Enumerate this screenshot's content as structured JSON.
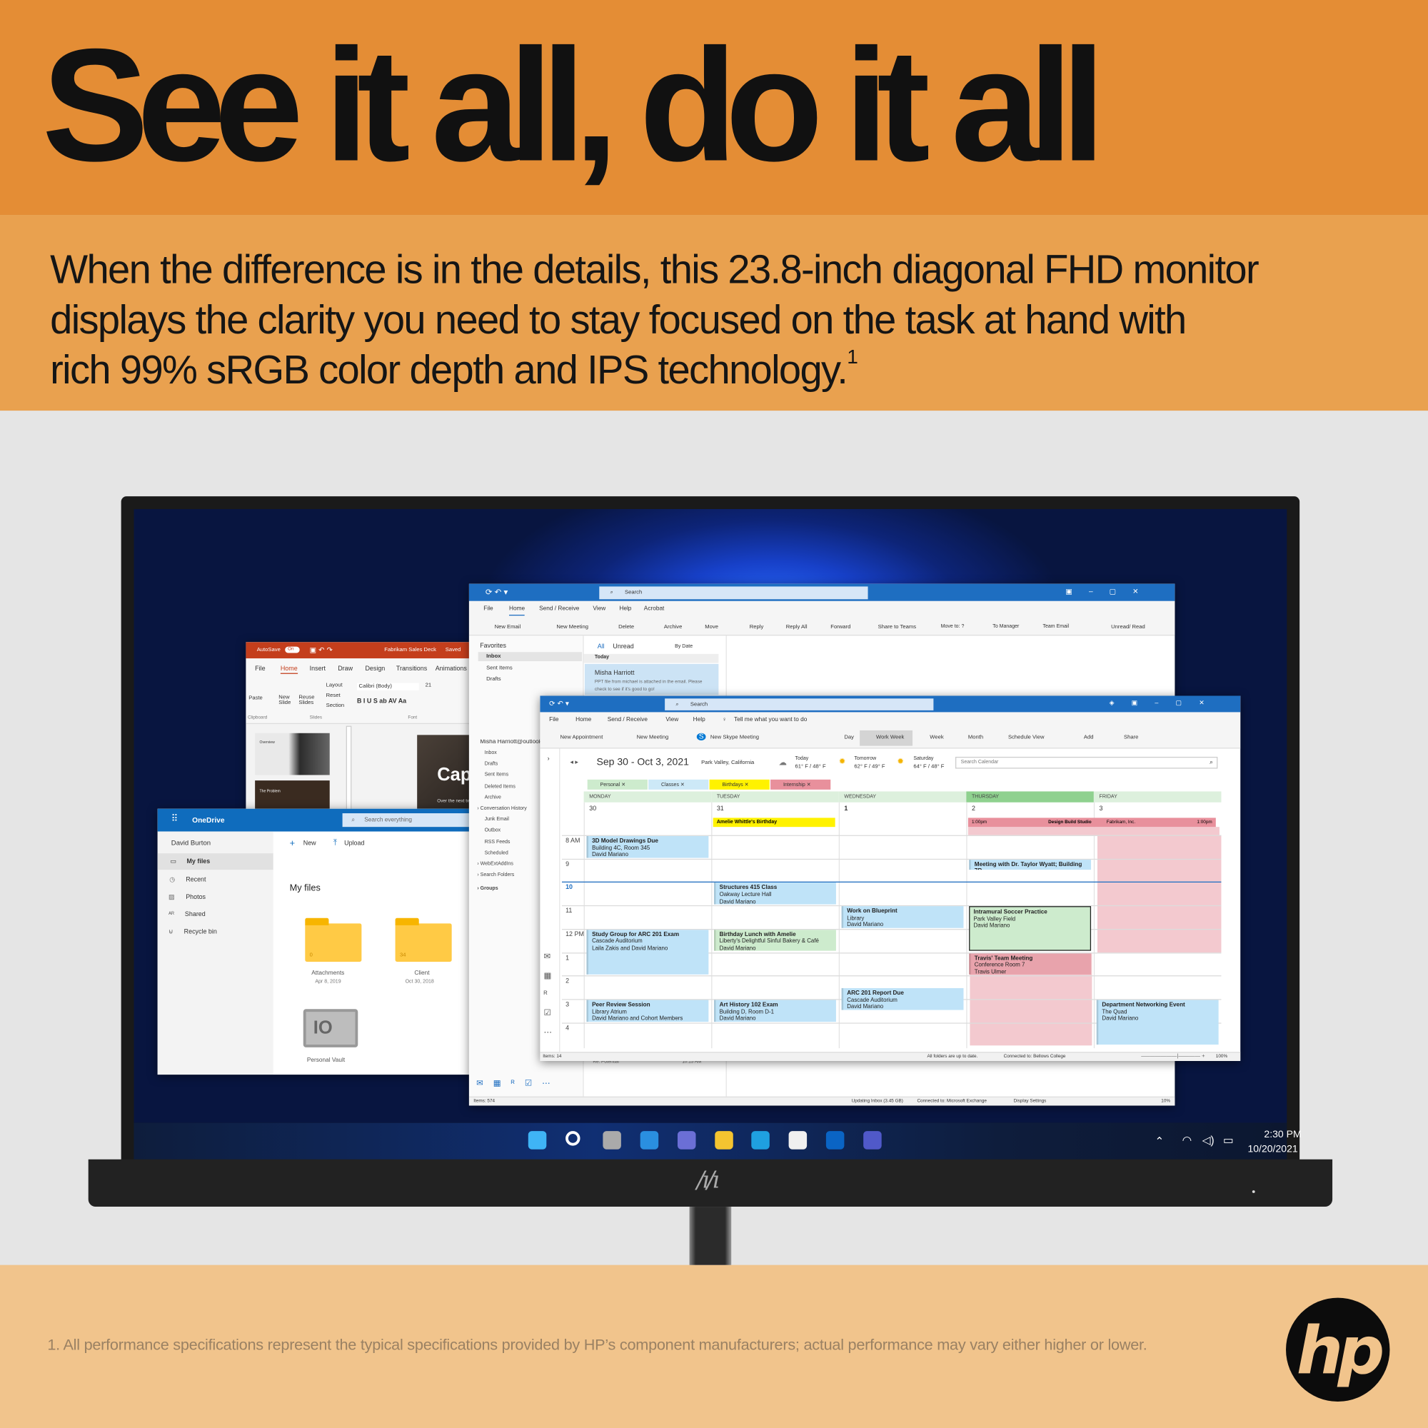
{
  "hero": {
    "headline": "See it all, do it all",
    "body_lines": [
      "When the difference is in the details, this 23.8-inch diagonal FHD monitor",
      "displays the clarity you need to stay focused on the task at hand with",
      "rich 99% sRGB color depth and IPS technology."
    ],
    "footnote_mark": "1",
    "footnote": "1. All performance specifications represent the typical specifications provided by HP’s component manufacturers; actual performance may vary either higher or lower.",
    "brand_logo": "hp"
  },
  "colors": {
    "band_top": "#E48D35",
    "band_sub": "#E9A14F",
    "band_bottom": "#F1C48C",
    "outlook_blue": "#1E6EC1",
    "ppt_red": "#C43E1C"
  },
  "powerpoint": {
    "autosave": "AutoSave",
    "autosave_state": "On",
    "doc_title": "Fabrikam Sales Deck",
    "saved": "Saved",
    "tabs": [
      "File",
      "Home",
      "Insert",
      "Draw",
      "Design",
      "Transitions",
      "Animations"
    ],
    "ribbon": {
      "paste": "Paste",
      "new_slide": "New Slide",
      "reuse": "Reuse Slides",
      "layout": "Layout",
      "reset": "Reset",
      "section": "Section",
      "font": "Calibri (Body)",
      "size": "21",
      "groups": [
        "Clipboard",
        "Slides",
        "Font"
      ]
    },
    "slide_text": "Cap",
    "slide_sub": "Over the next tw",
    "thumb1": "Overview",
    "thumb2": "The Problem"
  },
  "onedrive": {
    "app": "OneDrive",
    "search_placeholder": "Search everything",
    "user": "David Burton",
    "nav": [
      "My files",
      "Recent",
      "Photos",
      "Shared",
      "Recycle bin"
    ],
    "new": "New",
    "upload": "Upload",
    "heading": "My files",
    "items": [
      {
        "name": "Attachments",
        "date": "Apr 8, 2019",
        "count": "0"
      },
      {
        "name": "Client",
        "date": "Oct 30, 2018",
        "count": "34"
      },
      {
        "name": "Personal Vault"
      }
    ]
  },
  "mail": {
    "search": "Search",
    "menu": [
      "File",
      "Home",
      "Send / Receive",
      "View",
      "Help",
      "Acrobat"
    ],
    "ribbon": [
      "New Email",
      "New Meeting",
      "Delete",
      "Archive",
      "Move",
      "Reply",
      "Reply All",
      "Forward",
      "Share to Teams",
      "Move to: ?",
      "To Manager",
      "Team Email",
      "Unread/ Read"
    ],
    "favorites": "Favorites",
    "fav_items": [
      "Inbox",
      "Sent Items",
      "Drafts"
    ],
    "account": "Misha Harriott@outlook.com",
    "folders": [
      "Inbox",
      "Drafts",
      "Sent Items",
      "Deleted Items",
      "Archive",
      "Conversation History",
      "Junk Email",
      "Outbox",
      "RSS Feeds",
      "Scheduled",
      "WebExtAddIns",
      "Search Folders",
      "Groups"
    ],
    "filter_all": "All",
    "filter_unread": "Unread",
    "sort": "By Date",
    "group": "Today",
    "message": {
      "from": "Misha Harriott",
      "preview": "PPT file from michael is attached in the email. Please check to see if it's good to go!"
    },
    "peek_subject": "Re: Potential",
    "peek_time": "10:15 AM",
    "status": {
      "items": "Items: 574",
      "updating": "Updating Inbox (3.45 GB)",
      "connected": "Connected to: Microsoft Exchange",
      "display": "Display Settings",
      "zoom": "10%"
    }
  },
  "calendar": {
    "search": "Search",
    "menu": [
      "File",
      "Home",
      "Send / Receive",
      "View",
      "Help"
    ],
    "tell_me": "Tell me what you want to do",
    "ribbon": [
      "New Appointment",
      "New Meeting",
      "New Skype Meeting",
      "Day",
      "Work Week",
      "Week",
      "Month",
      "Schedule View",
      "Add",
      "Share"
    ],
    "active_view": "Work Week",
    "range": "Sep 30 - Oct 3, 2021",
    "location": "Park Valley, California",
    "weather": [
      {
        "label": "Today",
        "temp": "61° F / 48° F"
      },
      {
        "label": "Tomorrow",
        "temp": "62° F / 49° F"
      },
      {
        "label": "Saturday",
        "temp": "64° F / 48° F"
      }
    ],
    "search_placeholder": "Search Calendar",
    "categories": [
      {
        "name": "Personal",
        "color": "#CDEBCD"
      },
      {
        "name": "Classes",
        "color": "#CDE9F7"
      },
      {
        "name": "Birthdays",
        "color": "#FFF200"
      },
      {
        "name": "Internship",
        "color": "#E8909C"
      }
    ],
    "days": [
      {
        "name": "MONDAY",
        "date": "30"
      },
      {
        "name": "TUESDAY",
        "date": "31"
      },
      {
        "name": "WEDNESDAY",
        "date": "1"
      },
      {
        "name": "THURSDAY",
        "date": "2"
      },
      {
        "name": "FRIDAY",
        "date": "3"
      }
    ],
    "hours": [
      "8 AM",
      "9",
      "10",
      "11",
      "12 PM",
      "1",
      "2",
      "3",
      "4"
    ],
    "allday": [
      {
        "day": 1,
        "title": "Amelie Whittle's Birthday",
        "color": "#FFF200"
      }
    ],
    "banner": {
      "start": "1:00pm",
      "title": "Design Build Studio",
      "org": "Fabrikam, Inc.",
      "end": "1:00pm"
    },
    "events": [
      {
        "day": 0,
        "start": 8,
        "dur": 1,
        "title": "3D Model Drawings Due",
        "loc": "Building 4C, Room 345",
        "who": "David Mariano",
        "color": "#BFE3F8"
      },
      {
        "day": 0,
        "start": 12,
        "dur": 2,
        "title": "Study Group for ARC 201 Exam",
        "loc": "Cascade Auditorium",
        "who": "Laila Zakis and David Mariano",
        "color": "#BFE3F8"
      },
      {
        "day": 0,
        "start": 15,
        "dur": 1,
        "title": "Peer Review Session",
        "loc": "Library Atrium",
        "who": "David Mariano and Cohort Members",
        "color": "#BFE3F8"
      },
      {
        "day": 1,
        "start": 10,
        "dur": 1,
        "title": "Structures 415 Class",
        "loc": "Oakway Lecture Hall",
        "who": "David Mariano",
        "color": "#BFE3F8"
      },
      {
        "day": 1,
        "start": 12,
        "dur": 1,
        "title": "Birthday Lunch with Amelie",
        "loc": "Liberty's Delightful Sinful Bakery & Café",
        "who": "David Mariano",
        "color": "#CDEBCD"
      },
      {
        "day": 1,
        "start": 15,
        "dur": 1,
        "title": "Art History 102 Exam",
        "loc": "Building D, Room D-1",
        "who": "David Mariano",
        "color": "#BFE3F8"
      },
      {
        "day": 2,
        "start": 11,
        "dur": 1,
        "title": "Work on Blueprint",
        "loc": "Library",
        "who": "David Mariano",
        "color": "#BFE3F8"
      },
      {
        "day": 2,
        "start": 14.5,
        "dur": 1,
        "title": "ARC 201 Report Due",
        "loc": "Cascade Auditorium",
        "who": "David Mariano",
        "color": "#BFE3F8"
      },
      {
        "day": 3,
        "start": 9,
        "dur": 0.5,
        "title": "Meeting with Dr. Taylor Wyatt; Building 7R",
        "loc": "",
        "who": "",
        "color": "#BFE3F8"
      },
      {
        "day": 3,
        "start": 11,
        "dur": 2,
        "title": "Intramural Soccer Practice",
        "loc": "Park Valley Field",
        "who": "David Mariano",
        "color": "#CDEBCD",
        "selected": true
      },
      {
        "day": 3,
        "start": 13,
        "dur": 1,
        "title": "Travis' Team Meeting",
        "loc": "Conference Room 7",
        "who": "Travis Ulmer",
        "color": "#E8A3AC"
      },
      {
        "day": 4,
        "start": 15,
        "dur": 2,
        "title": "Department Networking Event",
        "loc": "The Quad",
        "who": "David Mariano",
        "color": "#BFE3F8"
      }
    ],
    "status": {
      "items": "Items: 14",
      "uptodate": "All folders are up to date.",
      "connected": "Connected to: Bellows College",
      "zoom": "100%"
    }
  },
  "taskbar": {
    "icons": [
      "windows-start-icon",
      "search-icon",
      "task-view-icon",
      "widgets-icon",
      "teams-chat-icon",
      "file-explorer-icon",
      "edge-icon",
      "store-icon",
      "outlook-icon",
      "teams-icon"
    ],
    "time": "2:30 PM",
    "date": "10/20/2021"
  }
}
